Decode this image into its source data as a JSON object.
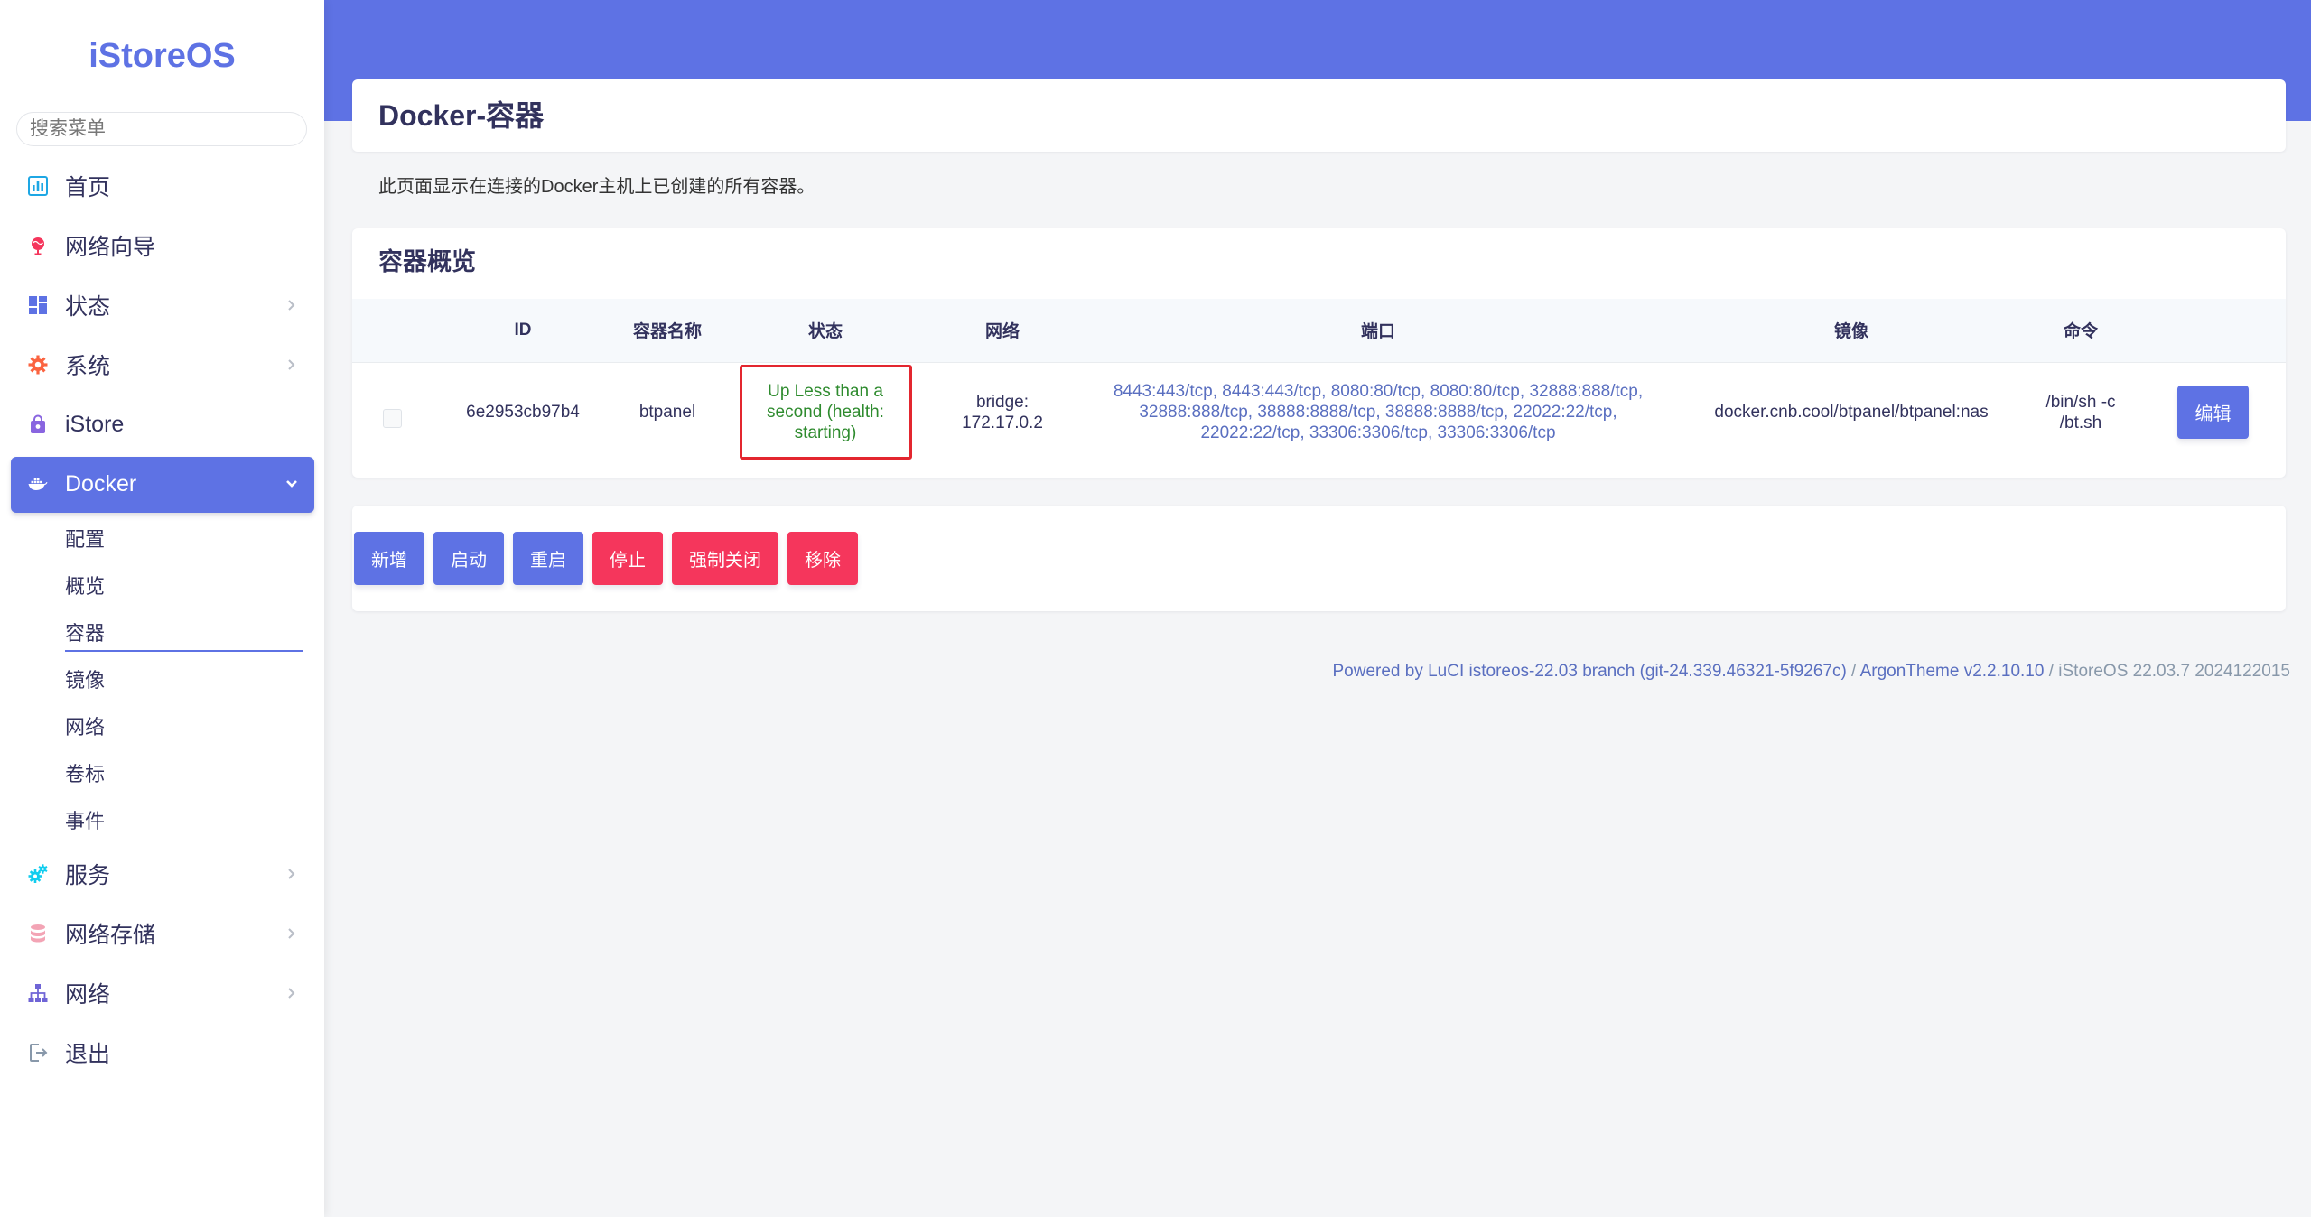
{
  "colors": {
    "primary": "#5e72e4",
    "danger": "#f5365c",
    "status_text": "#2e8b2e",
    "highlight_border": "#e3262f",
    "link": "#5a6fc0"
  },
  "sidebar": {
    "logo": "iStoreOS",
    "search_placeholder": "搜索菜单",
    "items": [
      {
        "label": "首页",
        "icon": "chart-bar-icon"
      },
      {
        "label": "网络向导",
        "icon": "globe-pin-icon"
      },
      {
        "label": "状态",
        "icon": "dashboard-icon",
        "expandable": true
      },
      {
        "label": "系统",
        "icon": "gear-icon",
        "expandable": true
      },
      {
        "label": "iStore",
        "icon": "shopping-bag-icon"
      },
      {
        "label": "Docker",
        "icon": "docker-whale-icon",
        "expandable": true,
        "active": true
      },
      {
        "label": "服务",
        "icon": "cogs-icon",
        "expandable": true
      },
      {
        "label": "网络存储",
        "icon": "database-icon",
        "expandable": true
      },
      {
        "label": "网络",
        "icon": "sitemap-icon",
        "expandable": true
      },
      {
        "label": "退出",
        "icon": "sign-out-icon"
      }
    ],
    "docker_submenu": [
      {
        "label": "配置"
      },
      {
        "label": "概览"
      },
      {
        "label": "容器",
        "active": true
      },
      {
        "label": "镜像"
      },
      {
        "label": "网络"
      },
      {
        "label": "卷标"
      },
      {
        "label": "事件"
      }
    ]
  },
  "page": {
    "title": "Docker-容器",
    "description": "此页面显示在连接的Docker主机上已创建的所有容器。"
  },
  "overview": {
    "heading": "容器概览",
    "columns": {
      "id": "ID",
      "name": "容器名称",
      "status": "状态",
      "network": "网络",
      "ports": "端口",
      "image": "镜像",
      "command": "命令"
    },
    "rows": [
      {
        "selected": false,
        "id": "6e2953cb97b4",
        "name": "btpanel",
        "status": "Up Less than a second (health: starting)",
        "network": "bridge: 172.17.0.2",
        "ports": [
          "8443:443/tcp",
          "8443:443/tcp",
          "8080:80/tcp",
          "8080:80/tcp",
          "32888:888/tcp",
          "32888:888/tcp",
          "38888:8888/tcp",
          "38888:8888/tcp",
          "22022:22/tcp",
          "22022:22/tcp",
          "33306:3306/tcp",
          "33306:3306/tcp"
        ],
        "port_separator": ", ",
        "image": "docker.cnb.cool/btpanel/btpanel:nas",
        "command": "/bin/sh -c /bt.sh",
        "edit_label": "编辑"
      }
    ]
  },
  "actions": [
    {
      "label": "新增",
      "color": "#5e72e4"
    },
    {
      "label": "启动",
      "color": "#5e72e4"
    },
    {
      "label": "重启",
      "color": "#5e72e4"
    },
    {
      "label": "停止",
      "color": "#f5365c"
    },
    {
      "label": "强制关闭",
      "color": "#f5365c"
    },
    {
      "label": "移除",
      "color": "#f5365c"
    }
  ],
  "footer": {
    "luci": "Powered by LuCI istoreos-22.03 branch (git-24.339.46321-5f9267c)",
    "separator": " / ",
    "theme": "ArgonTheme v2.2.10.10",
    "version": "iStoreOS 22.03.7 2024122015"
  }
}
